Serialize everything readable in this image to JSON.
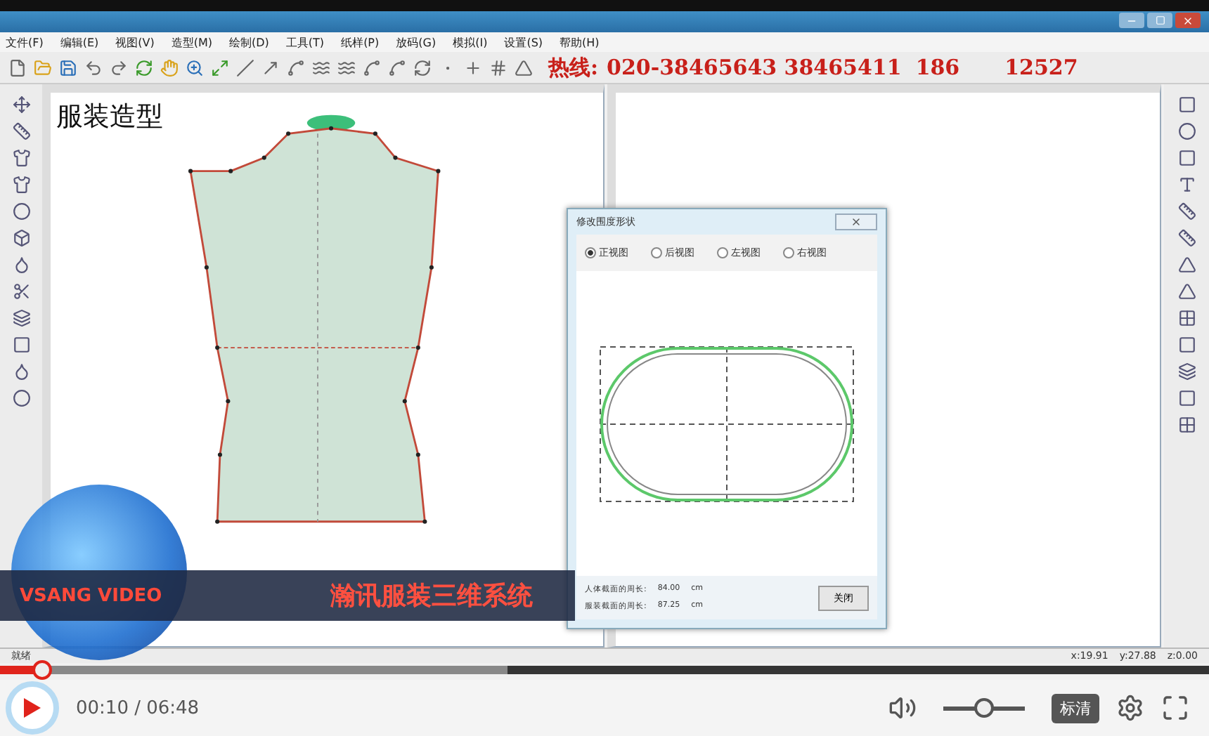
{
  "menu": [
    "文件(F)",
    "编辑(E)",
    "视图(V)",
    "造型(M)",
    "绘制(D)",
    "工具(T)",
    "纸样(P)",
    "放码(G)",
    "模拟(I)",
    "设置(S)",
    "帮助(H)"
  ],
  "hotline": {
    "label": "热线:",
    "numbers": "020-38465643 38465411",
    "tail_start": "186",
    "tail_end": "12527"
  },
  "canvas": {
    "title": "服装造型"
  },
  "dialog": {
    "title": "修改围度形状",
    "views": [
      {
        "label": "正视图",
        "selected": true
      },
      {
        "label": "后视图",
        "selected": false
      },
      {
        "label": "左视图",
        "selected": false
      },
      {
        "label": "右视图",
        "selected": false
      }
    ],
    "measures": [
      {
        "label": "人体截面的周长:",
        "value": "84.00",
        "unit": "cm"
      },
      {
        "label": "服装截面的周长:",
        "value": "87.25",
        "unit": "cm"
      }
    ],
    "close_button": "关闭"
  },
  "banner": {
    "logo": "VSANG VIDEO",
    "title": "瀚讯服装三维系统"
  },
  "status_bar": {
    "message": "就绪",
    "coords": [
      "x:19.91",
      "y:27.88",
      "z:0.00"
    ]
  },
  "player": {
    "progress": {
      "level": 0.035
    },
    "time": "00:10 / 06:48",
    "volume": {
      "level": 0.5
    },
    "quality": "标清"
  }
}
